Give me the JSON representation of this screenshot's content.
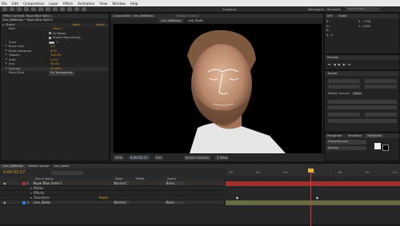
{
  "menu": [
    "File",
    "Edit",
    "Composition",
    "Layer",
    "Effect",
    "Animation",
    "View",
    "Window",
    "Help"
  ],
  "toolbar": {
    "snapping_label": "Snapping",
    "workspace_label": "Workspace:",
    "workspace_value": "Standard",
    "search_placeholder": "Search Help"
  },
  "effect_controls": {
    "tab_label": "Effect Controls: Royal Blue Solid 1",
    "breadcrumb": "Line_NoMotion • Royal Blue Solid 1",
    "effect_name": "Stroke",
    "reset_label": "Reset",
    "about_label": "About...",
    "properties": [
      {
        "name": "Path",
        "value": "Mask 1"
      },
      {
        "name": "All Masks",
        "value": ""
      },
      {
        "name": "Stroke Sequentially",
        "value": ""
      },
      {
        "name": "Color",
        "value": ""
      },
      {
        "name": "Brush Size",
        "value": "2.0"
      },
      {
        "name": "Brush Hardness",
        "value": "87%"
      },
      {
        "name": "Opacity",
        "value": "100.0%"
      },
      {
        "name": "Start",
        "value": "0.0%"
      },
      {
        "name": "End",
        "value": "90.4%"
      },
      {
        "name": "Spacing",
        "value": "15.00%"
      },
      {
        "name": "Paint Style",
        "value": "On Transparent"
      }
    ]
  },
  "composition": {
    "tab_label": "Composition: Line_NoMotion",
    "footage_tab": "Footage: (none)",
    "subtabs": [
      "Line_NoMotion",
      "Line_Static"
    ],
    "zoom": "50%",
    "timecode": "0:00:05:17",
    "resolution": "Full",
    "camera": "Active Camera",
    "views": "1 View"
  },
  "info_panel": {
    "tabs": [
      "Info",
      "Audio"
    ],
    "r": "R :",
    "g": "G :",
    "b": "B :",
    "a": "A : 0",
    "x": "X : 1758",
    "y": "Y : 1038"
  },
  "preview_panel": {
    "tab": "Preview"
  },
  "tracker_panel": {
    "tab": "Tracker",
    "motion_source": "Motion Source:",
    "motion_source_value": "None"
  },
  "character_panel": {
    "tabs": [
      "Paragraph",
      "Smoother",
      "Character"
    ],
    "font": "Geogrotesque",
    "style": "Regular"
  },
  "timeline": {
    "tabs": [
      "Line_NoMotion",
      "Render Queue",
      "Line_Static"
    ],
    "timecode": "0:00:05:17",
    "columns": {
      "source": "Source Name",
      "mode": "Mode",
      "trkmat": "TrkMat",
      "parent": "Parent"
    },
    "layers": [
      {
        "index": "1",
        "name": "Royal Blue Solid 1",
        "mode": "Normal",
        "parent": "None"
      },
      {
        "index": "",
        "name": "Masks",
        "mode": "",
        "parent": ""
      },
      {
        "index": "",
        "name": "Effects",
        "mode": "",
        "parent": ""
      },
      {
        "index": "",
        "name": "Transform",
        "mode": "",
        "parent": ""
      },
      {
        "index": "2",
        "name": "Line_Static",
        "mode": "Normal",
        "parent": "None"
      }
    ],
    "ruler_labels": [
      "00s",
      "02s",
      "04s",
      "06s",
      "08s",
      "10s",
      "12s"
    ],
    "reset_label": "Reset"
  }
}
